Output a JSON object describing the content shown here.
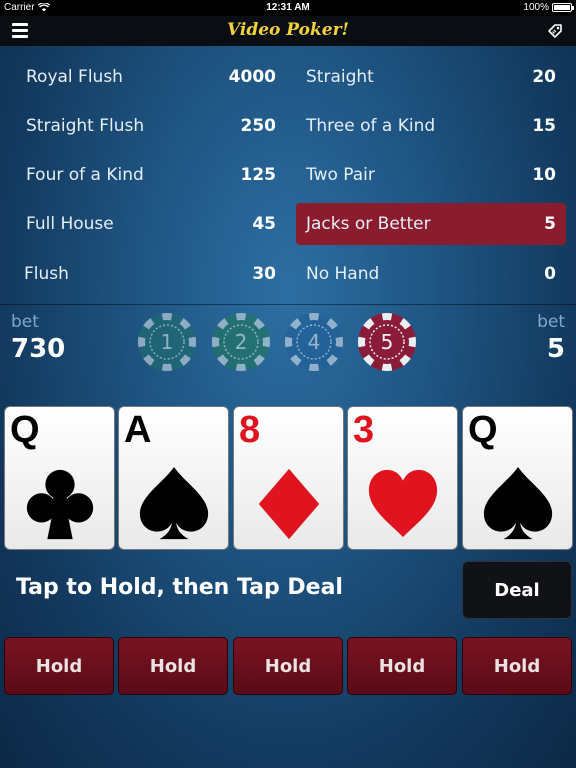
{
  "status_bar": {
    "carrier": "Carrier",
    "time": "12:31 AM",
    "battery": "100%"
  },
  "nav": {
    "title": "Video Poker!",
    "menu_icon": "hamburger-menu-icon",
    "right_icon": "price-tag-icon"
  },
  "paytable": {
    "left": [
      {
        "name": "Royal Flush",
        "value": "4000"
      },
      {
        "name": "Straight Flush",
        "value": "250"
      },
      {
        "name": "Four of a Kind",
        "value": "125"
      },
      {
        "name": "Full House",
        "value": "45"
      },
      {
        "name": "Flush",
        "value": "30"
      }
    ],
    "right": [
      {
        "name": "Straight",
        "value": "20"
      },
      {
        "name": "Three of a Kind",
        "value": "15"
      },
      {
        "name": "Two Pair",
        "value": "10"
      },
      {
        "name": "Jacks or Better",
        "value": "5"
      },
      {
        "name": "No Hand",
        "value": "0"
      }
    ],
    "highlighted": "Jacks or Better",
    "highlight_color": "#8a1c2e"
  },
  "bet": {
    "left_label": "bet",
    "left_value": "730",
    "right_label": "bet",
    "right_value": "5",
    "chips": [
      {
        "label": "1",
        "color": "#1f6f6a",
        "active": false
      },
      {
        "label": "2",
        "color": "#1f7a55",
        "active": false
      },
      {
        "label": "4",
        "color": "#1f5f9a",
        "active": false
      },
      {
        "label": "5",
        "color": "#8a1c3a",
        "active": true
      }
    ]
  },
  "cards": [
    {
      "rank": "Q",
      "suit": "clubs",
      "color": "#000000"
    },
    {
      "rank": "A",
      "suit": "spades",
      "color": "#000000"
    },
    {
      "rank": "8",
      "suit": "diamonds",
      "color": "#e0141e"
    },
    {
      "rank": "3",
      "suit": "hearts",
      "color": "#e0141e"
    },
    {
      "rank": "Q",
      "suit": "spades",
      "color": "#000000"
    }
  ],
  "prompt": "Tap to Hold, then Tap Deal",
  "deal_label": "Deal",
  "hold_label": "Hold",
  "hold_buttons": [
    "Hold",
    "Hold",
    "Hold",
    "Hold",
    "Hold"
  ]
}
